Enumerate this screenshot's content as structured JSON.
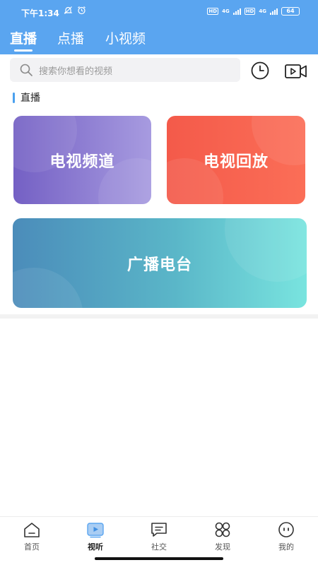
{
  "status_bar": {
    "time": "下午1:34",
    "network_badge": "HD",
    "network_type": "4G",
    "battery": "64"
  },
  "top_tabs": [
    {
      "label": "直播",
      "active": true
    },
    {
      "label": "点播",
      "active": false
    },
    {
      "label": "小视频",
      "active": false
    }
  ],
  "search": {
    "placeholder": "搜索你想看的视频",
    "icon": "search-icon"
  },
  "toolbar": {
    "history_icon": "clock-icon",
    "video_icon": "video-camera-icon"
  },
  "section": {
    "title": "直播"
  },
  "cards": [
    {
      "label": "电视频道",
      "color_start": "#7460c4",
      "color_end": "#a79be0"
    },
    {
      "label": "电视回放",
      "color_start": "#f45a4a",
      "color_end": "#fb6e57"
    },
    {
      "label": "广播电台",
      "color_start": "#4b8cba",
      "color_end": "#79e4df"
    }
  ],
  "bottom_nav": [
    {
      "label": "首页",
      "icon": "home-icon",
      "active": false
    },
    {
      "label": "视听",
      "icon": "play-icon",
      "active": true
    },
    {
      "label": "社交",
      "icon": "chat-icon",
      "active": false
    },
    {
      "label": "发现",
      "icon": "grid-icon",
      "active": false
    },
    {
      "label": "我的",
      "icon": "smiley-icon",
      "active": false
    }
  ],
  "colors": {
    "header_blue": "#5aa5f0",
    "accent_blue": "#4aa0ee"
  }
}
